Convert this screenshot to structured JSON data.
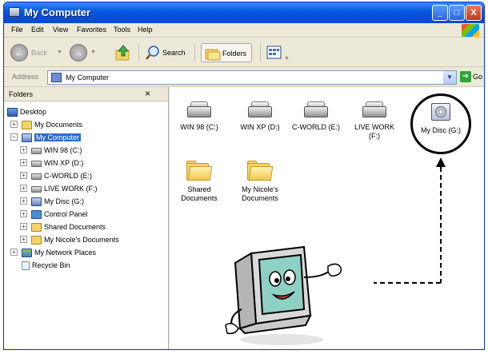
{
  "window": {
    "title": "My Computer"
  },
  "titlebar_buttons": {
    "minimize": "_",
    "maximize": "□",
    "close": "X"
  },
  "menu": [
    "File",
    "Edit",
    "View",
    "Favorites",
    "Tools",
    "Help"
  ],
  "toolbar": {
    "back": "Back",
    "forward": "",
    "search": "Search",
    "folders": "Folders"
  },
  "address": {
    "label": "Address",
    "value": "My Computer",
    "go": "Go"
  },
  "folders_pane": {
    "title": "Folders",
    "close": "×",
    "items": [
      {
        "label": "Desktop"
      },
      {
        "label": "My Documents"
      },
      {
        "label": "My Computer"
      },
      {
        "label": "WIN 98 (C:)"
      },
      {
        "label": "WIN XP (D:)"
      },
      {
        "label": "C-WORLD (E:)"
      },
      {
        "label": "LIVE WORK (F:)"
      },
      {
        "label": "My Disc (G:)"
      },
      {
        "label": "Control Panel"
      },
      {
        "label": "Shared Documents"
      },
      {
        "label": "My Nicole's Documents"
      },
      {
        "label": "My Network Places"
      },
      {
        "label": "Recycle Bin"
      }
    ]
  },
  "content": {
    "drives": [
      {
        "label": "WIN 98 (C:)"
      },
      {
        "label": "WIN XP (D:)"
      },
      {
        "label": "C-WORLD (E:)"
      },
      {
        "label": "LIVE WORK (F:)"
      },
      {
        "label": "My Disc (G:)"
      }
    ],
    "folders": [
      {
        "label": "Shared Documents"
      },
      {
        "label": "My Nicole's Documents"
      }
    ]
  },
  "icons": {
    "title": "computer-icon",
    "menu_logo": "windows-logo-icon",
    "back": "back-arrow-icon",
    "forward": "forward-arrow-icon",
    "up": "folder-up-icon",
    "search": "search-icon",
    "folders": "folders-icon",
    "views": "views-icon",
    "go": "go-arrow-icon",
    "mascot": "monitor-mascot-icon"
  },
  "colors": {
    "titlebar": "#0A5BE2",
    "selection": "#316AC5",
    "chrome": "#ECE9D8"
  }
}
